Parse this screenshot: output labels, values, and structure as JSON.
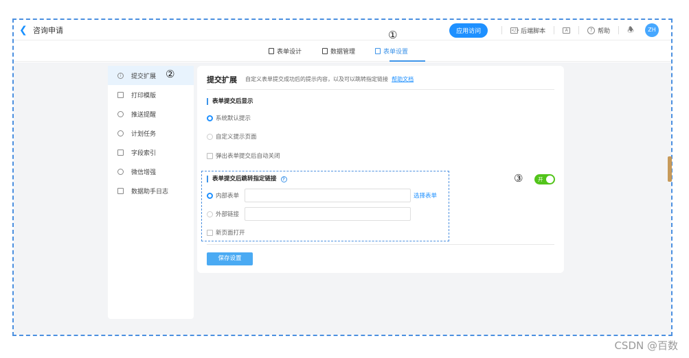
{
  "header": {
    "back_icon": "chevron-left-icon",
    "title": "咨询申请",
    "visit_button": "应用访问",
    "backend_script": "后端脚本",
    "help": "帮助",
    "avatar": "ZH"
  },
  "tabs": [
    {
      "label": "表单设计"
    },
    {
      "label": "数据管理"
    },
    {
      "label": "表单设置"
    }
  ],
  "markers": {
    "one": "①",
    "two": "②",
    "three": "③"
  },
  "sidebar": {
    "items": [
      {
        "label": "提交扩展",
        "icon": "info-icon"
      },
      {
        "label": "打印模版",
        "icon": "printer-icon"
      },
      {
        "label": "推送提醒",
        "icon": "bell-icon"
      },
      {
        "label": "计划任务",
        "icon": "clock-icon"
      },
      {
        "label": "字段索引",
        "icon": "file-icon"
      },
      {
        "label": "微信增强",
        "icon": "wechat-icon"
      },
      {
        "label": "数据助手日志",
        "icon": "log-icon"
      }
    ]
  },
  "panel": {
    "title": "提交扩展",
    "desc": "自定义表单提交成功后的提示内容，以及可以跳转指定链接",
    "help_link": "帮助文档",
    "section1": "表单提交后显示",
    "radio_default": "系统默认提示",
    "radio_custom": "自定义提示页面",
    "check_popup": "弹出表单提交后自动关闭",
    "section2": "表单提交后跳转指定链接",
    "radio_internal": "内部表单",
    "select_form": "选择表单",
    "radio_external": "外部链接",
    "check_newpage": "新页面打开",
    "toggle_label": "开",
    "save": "保存设置"
  },
  "watermark": "CSDN @百数",
  "colors": {
    "accent": "#1e90ff",
    "toggle_on": "#52c41a",
    "frame": "#4a8fe0"
  }
}
